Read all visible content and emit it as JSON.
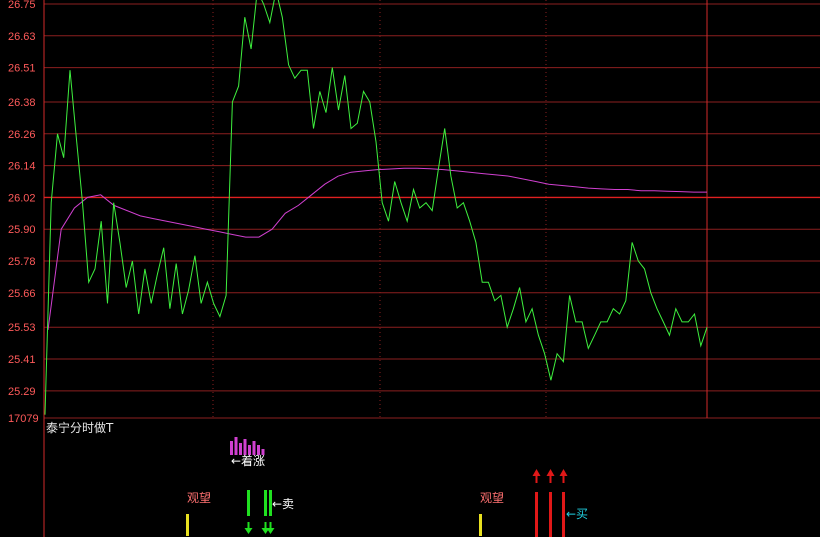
{
  "chart_data": {
    "type": "line",
    "indicator_title": "泰宁分时做T",
    "y_ticks": [
      "26.75",
      "26.63",
      "26.51",
      "26.38",
      "26.26",
      "26.14",
      "26.02",
      "25.90",
      "25.78",
      "25.66",
      "25.53",
      "25.41",
      "25.29",
      "17079"
    ],
    "ylim": [
      25.195,
      26.765
    ],
    "pre_close": 26.02,
    "colors": {
      "price": "#3ef03e",
      "avg": "#d040d0",
      "grid": "#8b1f1f",
      "axis": "#d22a2a",
      "ref": "#e02020"
    },
    "price": [
      25.2,
      26.0,
      26.26,
      26.17,
      26.5,
      26.25,
      26.0,
      25.7,
      25.75,
      25.93,
      25.62,
      26.0,
      25.85,
      25.68,
      25.78,
      25.58,
      25.75,
      25.62,
      25.73,
      25.83,
      25.6,
      25.77,
      25.58,
      25.67,
      25.8,
      25.62,
      25.7,
      25.62,
      25.57,
      25.65,
      26.38,
      26.44,
      26.7,
      26.58,
      26.8,
      26.75,
      26.68,
      26.8,
      26.7,
      26.52,
      26.47,
      26.5,
      26.5,
      26.28,
      26.42,
      26.34,
      26.51,
      26.35,
      26.48,
      26.28,
      26.3,
      26.42,
      26.38,
      26.23,
      26.0,
      25.93,
      26.08,
      26.0,
      25.93,
      26.05,
      25.98,
      26.0,
      25.97,
      26.13,
      26.28,
      26.1,
      25.98,
      26.0,
      25.93,
      25.85,
      25.7,
      25.7,
      25.63,
      25.65,
      25.53,
      25.6,
      25.68,
      25.55,
      25.6,
      25.5,
      25.43,
      25.33,
      25.43,
      25.4,
      25.65,
      25.55,
      25.55,
      25.45,
      25.5,
      25.55,
      25.55,
      25.6,
      25.58,
      25.63,
      25.85,
      25.78,
      25.75,
      25.66,
      25.6,
      25.55,
      25.5,
      25.6,
      25.55,
      25.55,
      25.58,
      25.46,
      25.53
    ],
    "avg": [
      25.52,
      25.9,
      25.98,
      26.02,
      26.03,
      25.99,
      25.97,
      25.95,
      25.94,
      25.93,
      25.92,
      25.91,
      25.9,
      25.89,
      25.88,
      25.87,
      25.87,
      25.9,
      25.96,
      25.99,
      26.03,
      26.07,
      26.1,
      26.115,
      26.12,
      26.125,
      26.127,
      26.13,
      26.13,
      26.128,
      26.125,
      26.12,
      26.115,
      26.11,
      26.105,
      26.1,
      26.09,
      26.08,
      26.07,
      26.065,
      26.06,
      26.055,
      26.052,
      26.05,
      26.05,
      26.045,
      26.045,
      26.043,
      26.042,
      26.04,
      26.04
    ],
    "signals": {
      "volume_label": "←着涨",
      "watch_label": "观望",
      "sell_label": "←卖",
      "buy_label": "←买"
    },
    "signal_colors": {
      "volume": "#d040d0",
      "watch": "#e8e020",
      "sell": "#20e020",
      "buy": "#e01818",
      "watch_text": "#ff7070",
      "buy_text": "#20d0e0",
      "label_text": "#ffffff"
    }
  }
}
